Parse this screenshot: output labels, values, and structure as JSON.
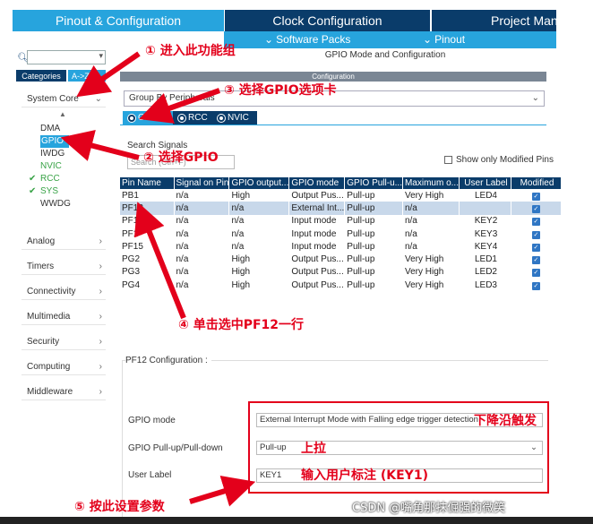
{
  "top_tabs": {
    "pinout": "Pinout & Configuration",
    "clock": "Clock Configuration",
    "project": "Project Mana"
  },
  "sub_bar": {
    "software_packs": "Software Packs",
    "pinout": "Pinout"
  },
  "left": {
    "search_placeholder": "",
    "categories_tab": "Categories",
    "az_tab": "A->Z",
    "groups": {
      "system_core": "System Core",
      "analog": "Analog",
      "timers": "Timers",
      "connectivity": "Connectivity",
      "multimedia": "Multimedia",
      "security": "Security",
      "computing": "Computing",
      "middleware": "Middleware"
    },
    "system_core_items": [
      "DMA",
      "GPIO",
      "IWDG",
      "NVIC",
      "RCC",
      "SYS",
      "WWDG"
    ]
  },
  "main": {
    "mode_title": "GPIO Mode and Configuration",
    "config_bar": "Configuration",
    "group_by": "Group By Peripherals",
    "tabs": [
      "GPIO",
      "RCC",
      "NVIC"
    ],
    "search_signals_label": "Search Signals",
    "search_signals_placeholder": "Search (Ctrl+F)",
    "show_modified": "Show only Modified Pins",
    "table": {
      "headers": [
        "Pin Name",
        "Signal on Pin",
        "GPIO output...",
        "GPIO mode",
        "GPIO Pull-u...",
        "Maximum o...",
        "User Label",
        "Modified"
      ],
      "rows": [
        [
          "PB1",
          "n/a",
          "High",
          "Output Pus...",
          "Pull-up",
          "Very High",
          "LED4"
        ],
        [
          "PF12",
          "n/a",
          "n/a",
          "External Int...",
          "Pull-up",
          "n/a",
          ""
        ],
        [
          "PF1",
          "n/a",
          "n/a",
          "Input mode",
          "Pull-up",
          "n/a",
          "KEY2"
        ],
        [
          "PF1",
          "n/a",
          "n/a",
          "Input mode",
          "Pull-up",
          "n/a",
          "KEY3"
        ],
        [
          "PF15",
          "n/a",
          "n/a",
          "Input mode",
          "Pull-up",
          "n/a",
          "KEY4"
        ],
        [
          "PG2",
          "n/a",
          "High",
          "Output Pus...",
          "Pull-up",
          "Very High",
          "LED1"
        ],
        [
          "PG3",
          "n/a",
          "High",
          "Output Pus...",
          "Pull-up",
          "Very High",
          "LED2"
        ],
        [
          "PG4",
          "n/a",
          "High",
          "Output Pus...",
          "Pull-up",
          "Very High",
          "LED3"
        ]
      ]
    },
    "config_section": {
      "title": "PF12 Configuration :",
      "gpio_mode_label": "GPIO mode",
      "gpio_mode_value": "External Interrupt Mode with Falling edge trigger detection",
      "pull_label": "GPIO Pull-up/Pull-down",
      "pull_value": "Pull-up",
      "user_label_label": "User Label",
      "user_label_value": "KEY1"
    }
  },
  "annotations": {
    "a1": "① 进入此功能组",
    "a2": "② 选择GPIO",
    "a3": "③ 选择GPIO选项卡",
    "a4": "④ 单击选中PF12一行",
    "a5": "⑤ 按此设置参数",
    "falling": "下降沿触发",
    "pullup": "上拉",
    "userlabel": "输入用户标注 (KEY1)"
  },
  "watermark": "CSDN @嘴角那抹倔强的微笑",
  "colors": {
    "light_blue": "#27a4dd",
    "dark_blue": "#0a3c6a",
    "annotation_red": "#e3001b"
  }
}
